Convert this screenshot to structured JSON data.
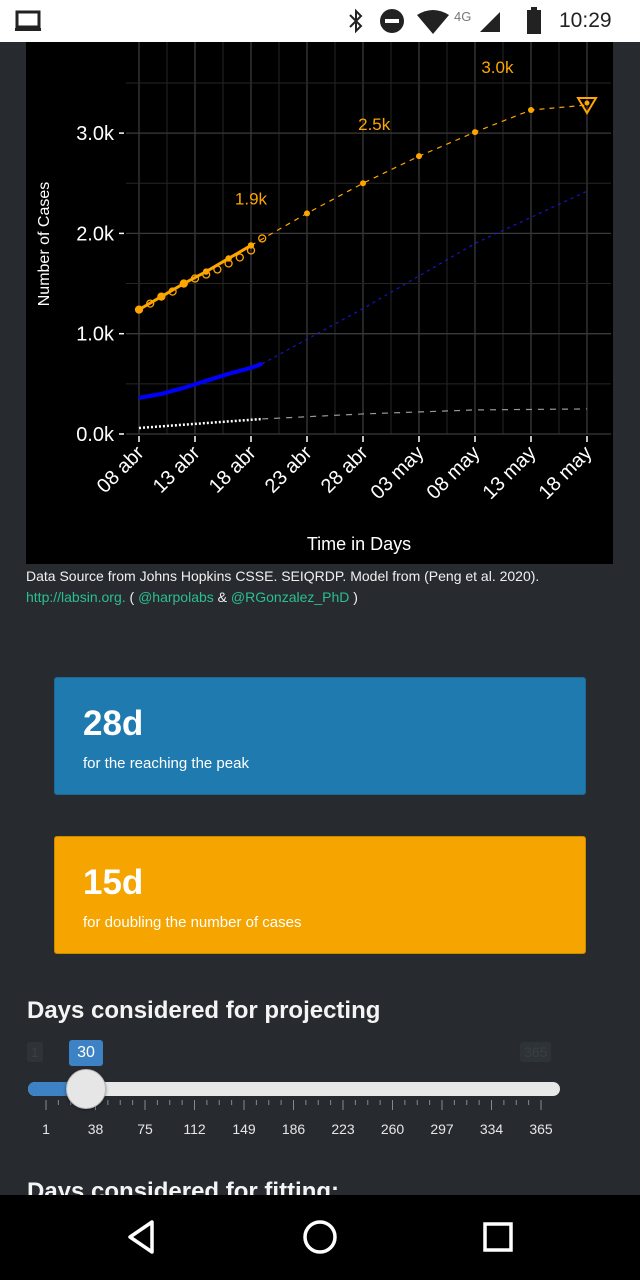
{
  "status_bar": {
    "network": "4G",
    "time": "10:29"
  },
  "chart_data": {
    "type": "line",
    "xlabel": "Time in Days",
    "ylabel": "Number of Cases",
    "x_ticks": [
      "08 abr",
      "13 abr",
      "18 abr",
      "23 abr",
      "28 abr",
      "03 may",
      "08 may",
      "13 may",
      "18 may"
    ],
    "y_ticks": [
      "0.0k",
      "1.0k",
      "2.0k",
      "3.0k"
    ],
    "ylim": [
      0,
      3300
    ],
    "grid": true,
    "colors": {
      "confirmed": "#ffa500",
      "active": "#0000ff",
      "deaths": "#ffffff",
      "background": "#000000",
      "grid": "#333333"
    },
    "annotations": [
      {
        "text": "1.9k",
        "day": 10,
        "value": 2290
      },
      {
        "text": "2.5k",
        "day": 21,
        "value": 3030
      },
      {
        "text": "3.0k",
        "day": 32,
        "value": 3600
      }
    ],
    "series": [
      {
        "key": "confirmed_observed",
        "x": [
          0,
          1,
          2,
          3,
          4,
          5,
          6,
          7,
          8,
          9,
          10,
          11
        ],
        "values": [
          1240,
          1300,
          1370,
          1420,
          1500,
          1550,
          1590,
          1640,
          1700,
          1760,
          1830,
          1950
        ]
      },
      {
        "key": "confirmed_fit",
        "x": [
          0,
          2,
          4,
          6,
          8,
          10
        ],
        "values": [
          1240,
          1370,
          1500,
          1620,
          1750,
          1880
        ]
      },
      {
        "key": "confirmed_projection",
        "x": [
          10,
          15,
          20,
          25,
          30,
          35,
          40
        ],
        "values": [
          1880,
          2200,
          2500,
          2770,
          3010,
          3230,
          3280
        ]
      },
      {
        "key": "active_fit",
        "x": [
          0,
          2,
          4,
          6,
          8,
          10,
          11
        ],
        "values": [
          360,
          400,
          460,
          530,
          600,
          660,
          700
        ]
      },
      {
        "key": "active_projection",
        "x": [
          11,
          20,
          30,
          40
        ],
        "values": [
          700,
          1250,
          1900,
          2420
        ]
      },
      {
        "key": "deaths_fit",
        "x": [
          0,
          11
        ],
        "values": [
          60,
          150
        ]
      },
      {
        "key": "deaths_projection",
        "x": [
          11,
          20,
          30,
          40
        ],
        "values": [
          150,
          200,
          240,
          250
        ]
      }
    ]
  },
  "caption": {
    "line1": "Data Source from Johns Hopkins CSSE. SEIQRDP. Model from (Peng et al. 2020).",
    "link": "http://labsin.org.",
    "paren_open": " ( ",
    "twitter1": "@harpolabs",
    "amp": " & ",
    "twitter2": "@RGonzalez_PhD",
    "paren_close": " )"
  },
  "cards": {
    "peak": {
      "value": "28d",
      "label": "for the reaching the peak",
      "color": "#1f7ab0"
    },
    "doubling": {
      "value": "15d",
      "label": "for doubling the number of cases",
      "color": "#f5a400"
    }
  },
  "slider": {
    "title": "Days considered for projecting",
    "min_label": "1",
    "max_label": "365",
    "value_label": "30",
    "value": 30,
    "min": 1,
    "max": 365,
    "tick_labels": [
      "1",
      "38",
      "75",
      "112",
      "149",
      "186",
      "223",
      "260",
      "297",
      "334",
      "365"
    ]
  },
  "next_section": {
    "title": "Days considered for fitting:"
  }
}
